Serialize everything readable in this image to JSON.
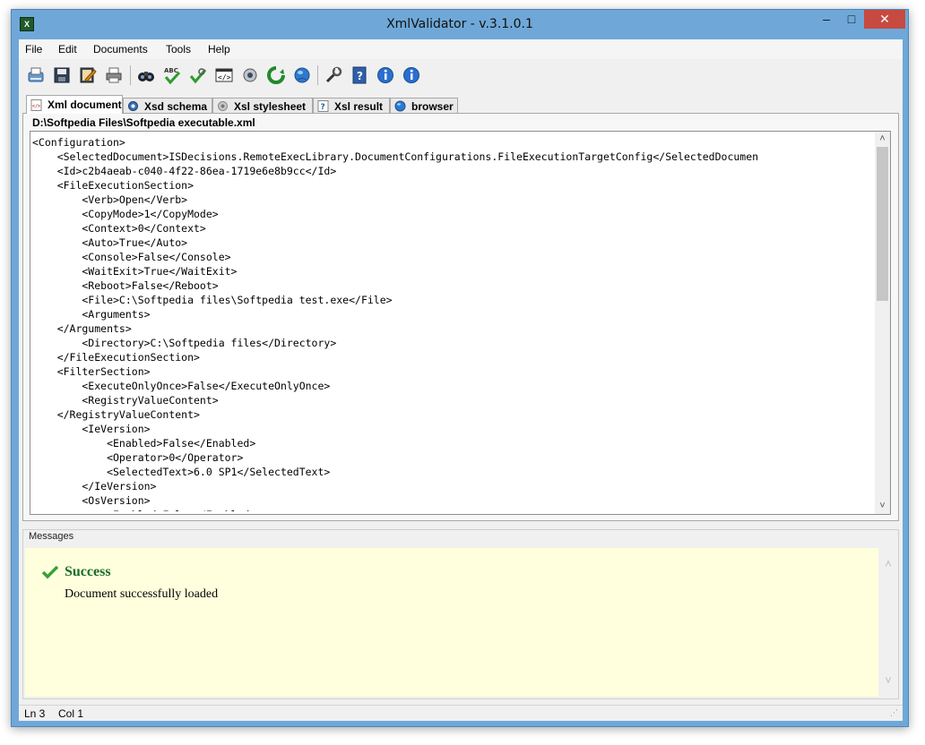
{
  "window": {
    "title": "XmlValidator - v.3.1.0.1",
    "app_icon_glyph": "X",
    "minimize_glyph": "–",
    "maximize_glyph": "□",
    "close_glyph": "✕"
  },
  "menu": [
    "File",
    "Edit",
    "Documents",
    "Tools",
    "Help"
  ],
  "toolbar": {
    "buttons": [
      "new-document-icon",
      "save-icon",
      "edit-icon",
      "print-icon",
      "find-icon",
      "spellcheck-icon",
      "validate-icon",
      "wizard-icon",
      "xml-code-icon",
      "settings-gear-icon",
      "refresh-icon",
      "web-globe-icon",
      "tools-wrench-icon",
      "help-book-icon",
      "info-icon"
    ]
  },
  "tabs": [
    {
      "label": "Xml document",
      "active": true,
      "icon": "xml-document-icon"
    },
    {
      "label": "Xsd schema",
      "active": false,
      "icon": "xsd-schema-icon"
    },
    {
      "label": "Xsl stylesheet",
      "active": false,
      "icon": "xsl-stylesheet-icon"
    },
    {
      "label": "Xsl result",
      "active": false,
      "icon": "xsl-result-icon"
    },
    {
      "label": "browser",
      "active": false,
      "icon": "browser-icon"
    }
  ],
  "document": {
    "path": "D:\\Softpedia Files\\Softpedia executable.xml",
    "lines": [
      "<Configuration>",
      "    <SelectedDocument>ISDecisions.RemoteExecLibrary.DocumentConfigurations.FileExecutionTargetConfig</SelectedDocumen",
      "    <Id>c2b4aeab-c040-4f22-86ea-1719e6e8b9cc</Id>",
      "    <FileExecutionSection>",
      "        <Verb>Open</Verb>",
      "        <CopyMode>1</CopyMode>",
      "        <Context>0</Context>",
      "        <Auto>True</Auto>",
      "        <Console>False</Console>",
      "        <WaitExit>True</WaitExit>",
      "        <Reboot>False</Reboot>",
      "        <File>C:\\Softpedia files\\Softpedia test.exe</File>",
      "        <Arguments>",
      "    </Arguments>",
      "        <Directory>C:\\Softpedia files</Directory>",
      "    </FileExecutionSection>",
      "    <FilterSection>",
      "        <ExecuteOnlyOnce>False</ExecuteOnlyOnce>",
      "        <RegistryValueContent>",
      "    </RegistryValueContent>",
      "        <IeVersion>",
      "            <Enabled>False</Enabled>",
      "            <Operator>0</Operator>",
      "            <SelectedText>6.0 SP1</SelectedText>",
      "        </IeVersion>",
      "        <OsVersion>",
      "            <Enabled>False</Enabled>"
    ]
  },
  "messages": {
    "label": "Messages",
    "title": "Success",
    "text": "Document successfully loaded"
  },
  "status": {
    "ln": "Ln 3",
    "col": "Col 1"
  },
  "colors": {
    "frame": "#6fa8d8",
    "close": "#c74a40",
    "success": "#1b6a2b",
    "messages_bg": "#ffffdd"
  }
}
